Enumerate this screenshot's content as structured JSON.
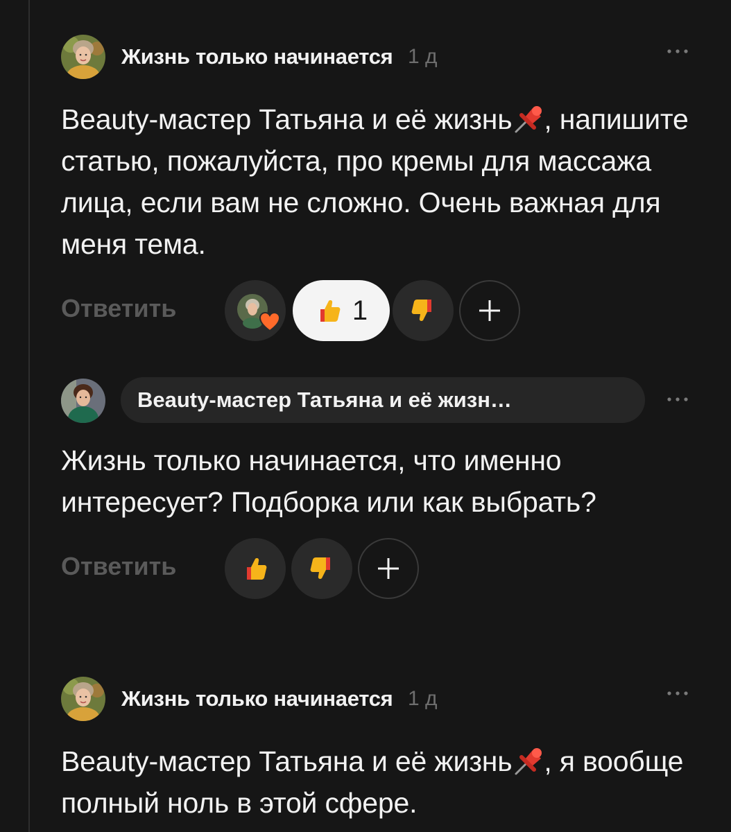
{
  "comments": [
    {
      "author": "Жизнь только начинается",
      "time": "1 д",
      "text_before": "Beauty-мастер Татьяна и её жизнь",
      "text_after": ", напишите статью, пожалуйста, про кремы для массажа лица, если вам не сложно. Очень важная для меня тема.",
      "reply_label": "Ответить",
      "like_count": "1",
      "icons": [
        "pin-icon",
        "thumbs-up-icon",
        "thumbs-down-icon",
        "plus-icon",
        "heart-icon",
        "more-icon"
      ]
    },
    {
      "reply_to": "Beauty-мастер Татьяна и её жизн…",
      "text": "Жизнь только начинается, что именно интересует? Подборка или как выбрать?",
      "reply_label": "Ответить",
      "icons": [
        "thumbs-up-icon",
        "thumbs-down-icon",
        "plus-icon",
        "more-icon"
      ]
    },
    {
      "author": "Жизнь только начинается",
      "time": "1 д",
      "text_before": "Beauty-мастер Татьяна и её жизнь",
      "text_after": ", я вообще полный ноль в этой сфере.",
      "icons": [
        "pin-icon",
        "more-icon"
      ]
    }
  ],
  "colors": {
    "background": "#161616",
    "text": "#f2f2f2",
    "muted": "#6e6e6e",
    "reply_link": "#5a5a5a",
    "chip_dark": "#2a2a2a",
    "chip_light": "#f4f4f4",
    "emoji_yellow": "#f6b41a",
    "emoji_red": "#e23a2f"
  }
}
